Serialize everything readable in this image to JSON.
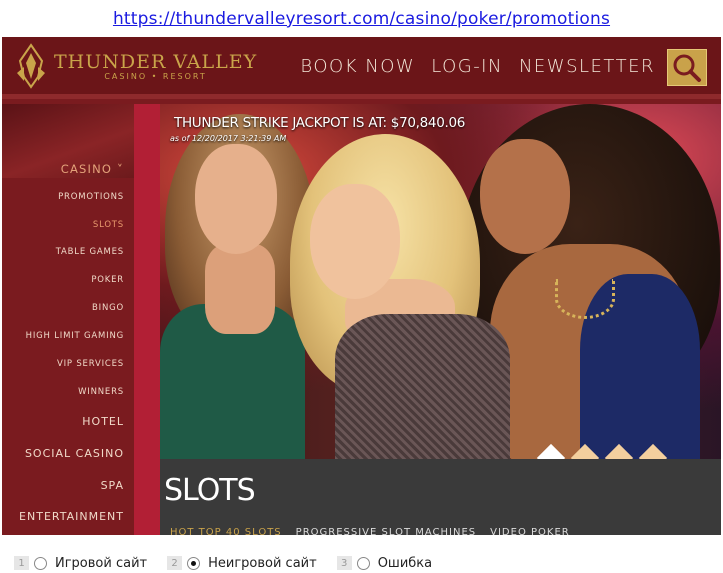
{
  "url": "https://thundervalleyresort.com/casino/poker/promotions",
  "header": {
    "logo_title": "THUNDER VALLEY",
    "logo_subtitle": "CASINO • RESORT",
    "nav": [
      "BOOK NOW",
      "LOG-IN",
      "NEWSLETTER"
    ],
    "search_icon": "search-icon"
  },
  "sidebar": {
    "section": "CASINO",
    "items": [
      "PROMOTIONS",
      "SLOTS",
      "TABLE GAMES",
      "POKER",
      "BINGO",
      "HIGH LIMIT GAMING",
      "VIP SERVICES",
      "WINNERS"
    ],
    "active_item": "SLOTS",
    "main_items": [
      "HOTEL",
      "SOCIAL CASINO",
      "SPA",
      "ENTERTAINMENT"
    ]
  },
  "hero": {
    "jackpot": "THUNDER STRIKE JACKPOT IS AT: $70,840.06",
    "jackpot_time": "as of 12/20/2017 3:21:39 AM"
  },
  "page": {
    "title": "SLOTS",
    "tabs": [
      "HOT TOP 40 SLOTS",
      "PROGRESSIVE SLOT MACHINES",
      "VIDEO POKER"
    ]
  },
  "survey": {
    "options": [
      {
        "num": "1",
        "label": "Игровой сайт",
        "checked": false
      },
      {
        "num": "2",
        "label": "Неигровой сайт",
        "checked": true
      },
      {
        "num": "3",
        "label": "Ошибка",
        "checked": false
      }
    ]
  },
  "colors": {
    "brand_red": "#7a1b1f",
    "gold": "#c9a24a",
    "accent_red": "#b21f35"
  }
}
